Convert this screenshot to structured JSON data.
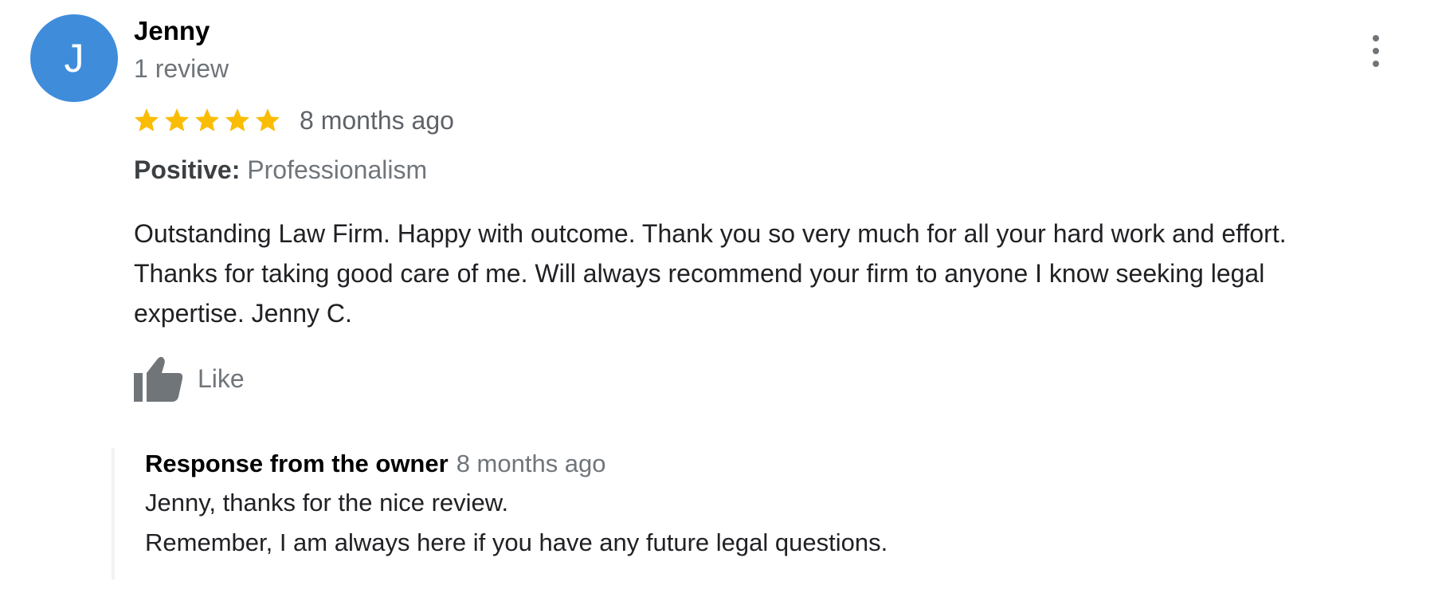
{
  "reviewer": {
    "avatar_letter": "J",
    "avatar_color": "#3f8cdb",
    "name": "Jenny",
    "review_count": "1 review"
  },
  "menu": {
    "icon": "more-vert-icon"
  },
  "rating": {
    "stars": 5,
    "max_stars": 5,
    "star_color": "#fbbc04",
    "time_ago": "8 months ago"
  },
  "highlight": {
    "label": "Positive:",
    "value": "Professionalism"
  },
  "review": {
    "text": "Outstanding Law Firm. Happy with outcome. Thank you so very much for all your hard work and effort.\nThanks for taking good care of me. Will always recommend your firm to anyone I know seeking legal\nexpertise. Jenny C."
  },
  "actions": {
    "like_label": "Like",
    "like_icon": "thumbs-up-icon"
  },
  "owner_response": {
    "title": "Response from the owner",
    "time_ago": "8 months ago",
    "text": "Jenny, thanks for the nice review.\nRemember, I am always here if you have any future legal questions."
  }
}
